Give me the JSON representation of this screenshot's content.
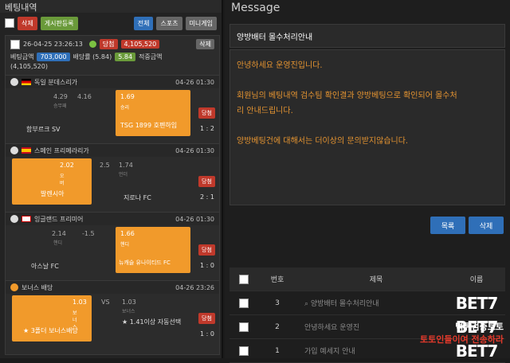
{
  "left": {
    "title": "베팅내역",
    "buttons": {
      "delete": "삭제",
      "bulletin": "게시판등록",
      "all": "전체",
      "sports": "스포츠",
      "mini": "미니게임"
    },
    "slip": {
      "datetime": "26-04-25 23:26:13",
      "status": "당첨",
      "amount_top": "4,105,520",
      "delete": "삭제",
      "bet_label": "베팅금액",
      "bet_amount": "703,000",
      "odds_label": "배당률 (5.84)",
      "odds_value": "5.84",
      "win_label": "적중금액",
      "win_amount": "(4,105,520)"
    },
    "games": [
      {
        "league": "독일 분데스리가",
        "time": "04-26 01:30",
        "home_team": "함부르크 SV",
        "away_team": "TSG 1899 호펜하임",
        "home_odds": "4.29",
        "draw_odds": "4.16",
        "away_odds": "1.69",
        "home_sub": "승무패",
        "away_sub": "승리",
        "result": "당첨",
        "score": "1 : 2"
      },
      {
        "league": "스페인 프리메라리가",
        "time": "04-26 01:30",
        "home_team": "발렌시아",
        "away_team": "지로나 FC",
        "home_odds": "2.02",
        "draw_odds": "2.5",
        "away_odds": "1.74",
        "home_sub": "오버",
        "away_sub": "언더",
        "result": "당첨",
        "score": "2 : 1"
      },
      {
        "league": "잉글랜드 프리미어",
        "time": "04-26 01:30",
        "home_team": "아스날 FC",
        "away_team": "뉴캐슬 유나이티드 FC",
        "home_odds": "2.14",
        "draw_odds": "-1.5",
        "away_odds": "1.66",
        "home_sub": "핸디",
        "away_sub": "핸디",
        "result": "당첨",
        "score": "1 : 0"
      },
      {
        "league": "보너스 배당",
        "time": "04-26 23:26",
        "home_team": "★ 3폴더 보너스배당",
        "away_team": "★ 1.41이상 자동선택",
        "home_odds": "1.03",
        "draw_odds": "VS",
        "away_odds": "1.03",
        "home_sub": "보너스",
        "away_sub": "보너스",
        "result": "당첨",
        "score": "1 : 0"
      }
    ]
  },
  "right": {
    "header": "Message",
    "subject": "양방배터 몰수처리안내",
    "body_lines": [
      "안녕하세요 운영진입니다.",
      "",
      "회원님의 베팅내역 검수팀 확인결과 양방베팅으로 확인되어 몰수처",
      "리 안내드립니다.",
      "",
      "양방베팅건에 대해서는 더이상의 문의받지않습니다."
    ],
    "btn_list": "목록",
    "btn_delete": "삭제",
    "table": {
      "headers": [
        "번호",
        "제목",
        "이름"
      ],
      "rows": [
        {
          "no": "3",
          "title": "양방배터 몰수처리안내"
        },
        {
          "no": "2",
          "title": "안녕하세요 운영진"
        },
        {
          "no": "1",
          "title": "가입 예세지 안내"
        }
      ]
    },
    "logo": "BET7",
    "watermark_top": "먹튀검증토토",
    "watermark_bottom": "토토인들이여 전송하라"
  },
  "colors": {
    "orange": "#f19a2b",
    "red": "#c0392b",
    "blue": "#2f6fb8",
    "text_orange": "#e59431"
  }
}
